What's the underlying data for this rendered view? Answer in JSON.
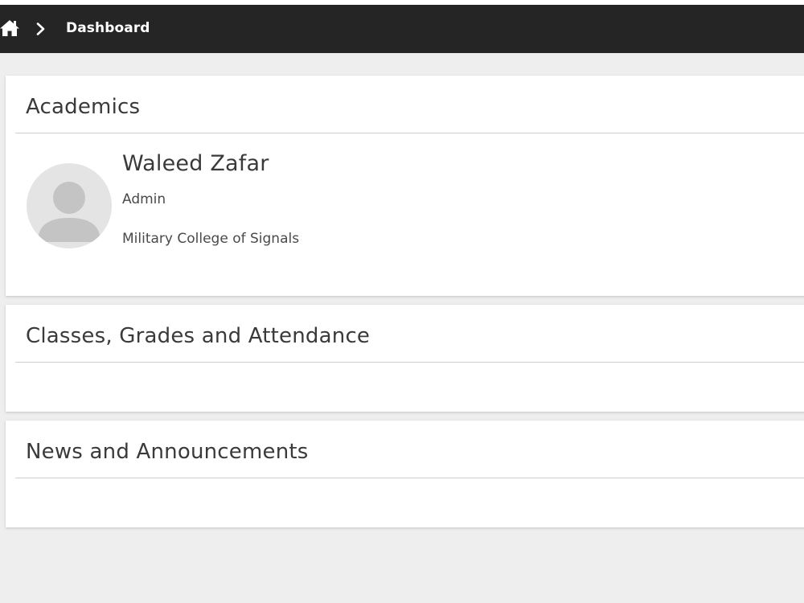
{
  "breadcrumb": {
    "home_icon": "home-icon",
    "separator_icon": "chevron-right-icon",
    "current": "Dashboard"
  },
  "colors": {
    "navbar": "#252525",
    "page_background": "#eeeeee",
    "card_background": "#ffffff",
    "text": "#3a3a3a"
  },
  "academics": {
    "title": "Academics",
    "profile": {
      "avatar_icon": "user-avatar-icon",
      "name": "Waleed Zafar",
      "role": "Admin",
      "organization": "Military College of Signals"
    }
  },
  "classes": {
    "title": "Classes, Grades and Attendance"
  },
  "news": {
    "title": "News and Announcements"
  }
}
